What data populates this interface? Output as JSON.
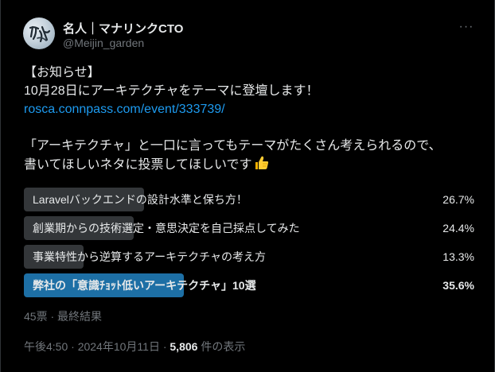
{
  "user": {
    "display_name": "名人｜マナリンクCTO",
    "handle": "@Meijin_garden"
  },
  "tweet": {
    "line1": "【お知らせ】",
    "line2": "10月28日にアーキテクチャをテーマに登壇します！",
    "link": "rosca.connpass.com/event/333739/",
    "line4": "「アーキテクチャ」と一口に言ってもテーマがたくさん考えられるので、",
    "line5": "書いてほしいネタに投票してほしいです"
  },
  "poll": {
    "options": [
      {
        "label": "Laravelバックエンドの設計水準と保ち方！",
        "percent_text": "26.7%",
        "percent": 26.7
      },
      {
        "label": "創業期からの技術選定・意思決定を自己採点してみた",
        "percent_text": "24.4%",
        "percent": 24.4
      },
      {
        "label": "事業特性から逆算するアーキテクチャの考え方",
        "percent_text": "13.3%",
        "percent": 13.3
      },
      {
        "label": "弊社の「意識ﾁｮｯﾄ低いアーキテクチャ」10選",
        "percent_text": "35.6%",
        "percent": 35.6
      }
    ],
    "meta": "45票 · 最終結果"
  },
  "timestamp": {
    "time": "午後4:50 · 2024年10月11日 · ",
    "views": "5,806",
    "views_suffix": " 件の表示"
  },
  "colors": {
    "background": "#000000",
    "text": "#e7e9ea",
    "secondary": "#71767b",
    "link": "#1d9bf0",
    "poll_bar": "#333639",
    "poll_winner": "#1d6fa5"
  },
  "icons": {
    "more": "more-horizontal-icon",
    "thumb": "thumbs-up-emoji"
  }
}
